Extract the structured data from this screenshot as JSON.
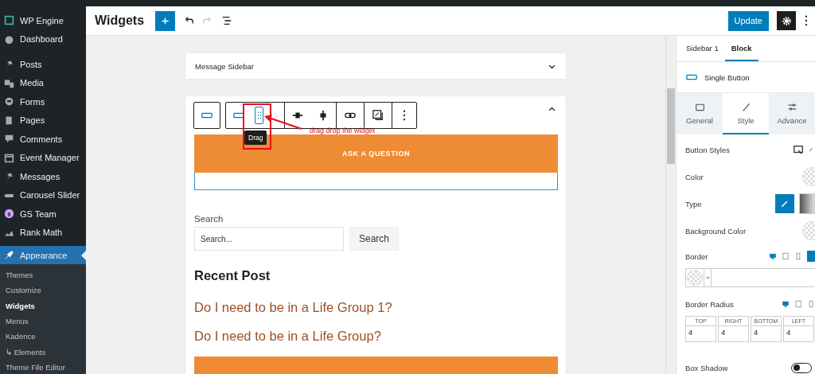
{
  "admin_menu": {
    "items": [
      {
        "label": "WP Engine",
        "selected": false
      },
      {
        "label": "Dashboard",
        "selected": false
      },
      {
        "label": "Posts",
        "selected": false
      },
      {
        "label": "Media",
        "selected": false
      },
      {
        "label": "Forms",
        "selected": false
      },
      {
        "label": "Pages",
        "selected": false
      },
      {
        "label": "Comments",
        "selected": false
      },
      {
        "label": "Event Manager",
        "selected": false
      },
      {
        "label": "Messages",
        "selected": false
      },
      {
        "label": "Carousel Slider",
        "selected": false
      },
      {
        "label": "GS Team",
        "selected": false
      },
      {
        "label": "Rank Math",
        "selected": false
      },
      {
        "label": "Appearance",
        "selected": true
      }
    ],
    "submenu": [
      {
        "label": "Themes",
        "selected": false
      },
      {
        "label": "Customize",
        "selected": false
      },
      {
        "label": "Widgets",
        "selected": true
      },
      {
        "label": "Menus",
        "selected": false
      },
      {
        "label": "Kadence",
        "selected": false
      },
      {
        "label": "↳ Elements",
        "selected": false
      },
      {
        "label": "Theme File Editor",
        "selected": false
      }
    ]
  },
  "header": {
    "title": "Widgets",
    "update_button": "Update"
  },
  "widget_areas": [
    {
      "title": "Message Sidebar",
      "expanded": false
    },
    {
      "expanded": true
    }
  ],
  "block_toolbar": {
    "tooltip": "Drag",
    "annotation": "drag drop the widget"
  },
  "button_block": {
    "label": "ASK A QUESTION"
  },
  "search_widget": {
    "label": "Search",
    "placeholder": "Search...",
    "button": "Search"
  },
  "recent_posts": {
    "heading": "Recent Post",
    "links": [
      "Do I need to be in a Life Group 1?",
      "Do I need to be in a Life Group?"
    ]
  },
  "inspector": {
    "tabs": [
      {
        "label": "Sidebar 1",
        "selected": false
      },
      {
        "label": "Block",
        "selected": true
      }
    ],
    "block_name": "Single Button",
    "style_tabs": [
      {
        "label": "General",
        "selected": false
      },
      {
        "label": "Style",
        "selected": true
      },
      {
        "label": "Advance",
        "selected": false
      }
    ],
    "settings": [
      {
        "kind": "icons",
        "label": "Button Styles"
      },
      {
        "kind": "color",
        "label": "Color"
      },
      {
        "kind": "type",
        "label": "Type"
      },
      {
        "kind": "color",
        "label": "Background Color"
      },
      {
        "kind": "border",
        "label": "Border"
      },
      {
        "kind": "radius",
        "label": "Border Radius",
        "corners": [
          {
            "label": "TOP",
            "value": "4"
          },
          {
            "label": "RIGHT",
            "value": "4"
          },
          {
            "label": "BOTTOM",
            "value": "4"
          },
          {
            "label": "LEFT",
            "value": "4"
          }
        ]
      },
      {
        "kind": "toggle",
        "label": "Box Shadow",
        "on": false
      }
    ]
  }
}
